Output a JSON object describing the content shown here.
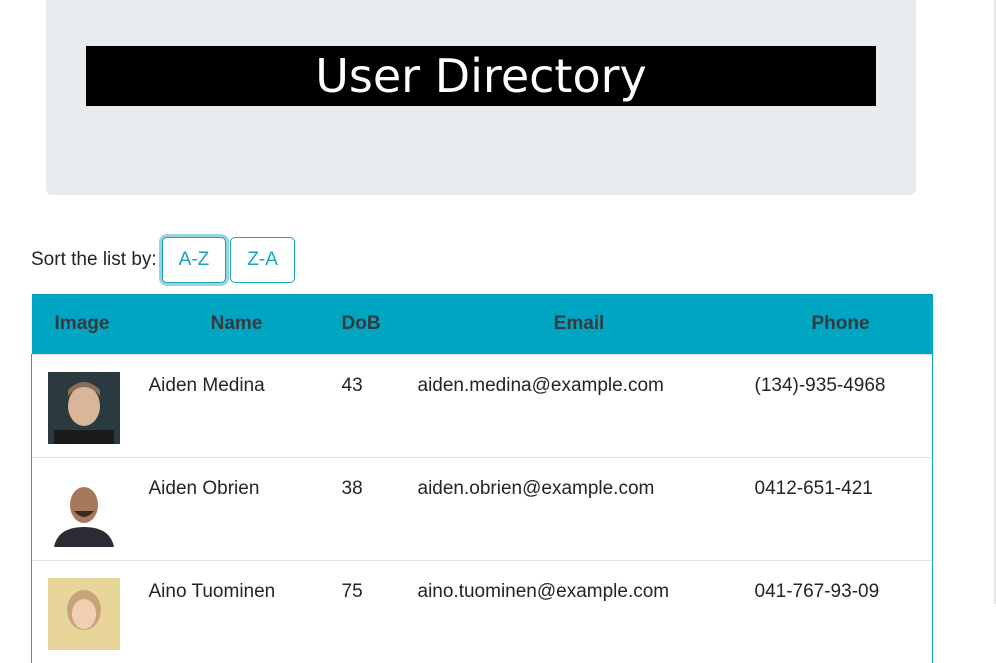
{
  "header": {
    "title": "User Directory"
  },
  "sort": {
    "label": "Sort the list by:",
    "buttons": [
      "A-Z",
      "Z-A"
    ]
  },
  "table": {
    "columns": [
      "Image",
      "Name",
      "DoB",
      "Email",
      "Phone"
    ],
    "rows": [
      {
        "name": "Aiden Medina",
        "dob": "43",
        "email": "aiden.medina@example.com",
        "phone": "(134)-935-4968",
        "avatar": "portrait-man-icon"
      },
      {
        "name": "Aiden Obrien",
        "dob": "38",
        "email": "aiden.obrien@example.com",
        "phone": "0412-651-421",
        "avatar": "portrait-man-bald-icon"
      },
      {
        "name": "Aino Tuominen",
        "dob": "75",
        "email": "aino.tuominen@example.com",
        "phone": "041-767-93-09",
        "avatar": "portrait-woman-icon"
      }
    ]
  },
  "colors": {
    "accent": "#17a2b8",
    "header_bg": "#00a5c1",
    "jumbotron": "#e9ecef"
  }
}
